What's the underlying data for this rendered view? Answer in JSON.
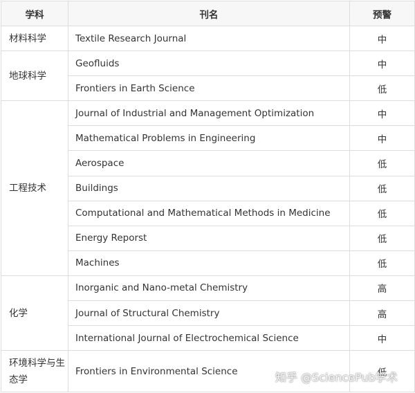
{
  "header": {
    "subject": "学科",
    "journal": "刊名",
    "warning": "预警"
  },
  "rows": [
    {
      "subject": "材料科学",
      "journal": "Textile Research Journal",
      "warning": "中"
    },
    {
      "subject": "地球科学",
      "journal": "Geofluids",
      "warning": "中"
    },
    {
      "journal": "Frontiers in Earth Science",
      "warning": "低"
    },
    {
      "subject": "工程技术",
      "journal": "Journal of Industrial and Management Optimization",
      "warning": "中"
    },
    {
      "journal": "Mathematical Problems in Engineering",
      "warning": "中"
    },
    {
      "journal": "Aerospace",
      "warning": "低"
    },
    {
      "journal": "Buildings",
      "warning": "低"
    },
    {
      "journal": "Computational and Mathematical Methods in Medicine",
      "warning": "低"
    },
    {
      "journal": "Energy Reporst",
      "warning": "低"
    },
    {
      "journal": "Machines",
      "warning": "低"
    },
    {
      "subject": "化学",
      "journal": "Inorganic and Nano-metal Chemistry",
      "warning": "高"
    },
    {
      "journal": "Journal of Structural Chemistry",
      "warning": "高"
    },
    {
      "journal": "International Journal of  Electrochemical Science",
      "warning": "中"
    },
    {
      "subject": "环境科学与生态学",
      "journal": "Frontiers in Environmental Science",
      "warning": "低"
    }
  ],
  "watermark": "知乎 @SciencePub学术"
}
